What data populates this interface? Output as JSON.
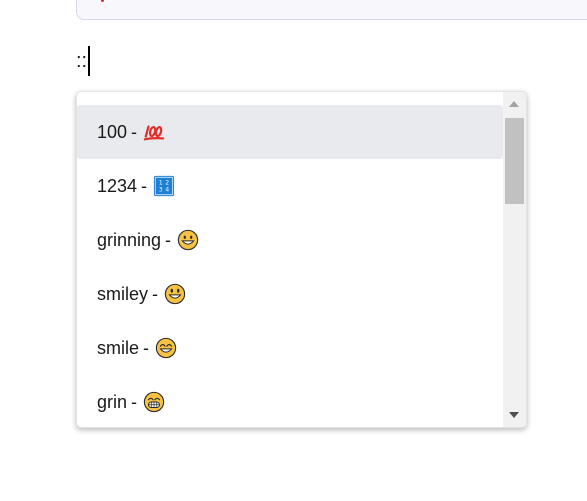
{
  "editor": {
    "typed_text": "::"
  },
  "autocomplete": {
    "items": [
      {
        "label": "100",
        "separator": "-",
        "emoji": "hundred-points-icon",
        "selected": true
      },
      {
        "label": "1234",
        "separator": "-",
        "emoji": "input-numbers-icon",
        "selected": false
      },
      {
        "label": "grinning",
        "separator": "-",
        "emoji": "grinning-face-icon",
        "selected": false
      },
      {
        "label": "smiley",
        "separator": "-",
        "emoji": "smiley-face-icon",
        "selected": false
      },
      {
        "label": "smile",
        "separator": "-",
        "emoji": "smile-face-icon",
        "selected": false
      },
      {
        "label": "grin",
        "separator": "-",
        "emoji": "grin-face-icon",
        "selected": false
      }
    ]
  },
  "colors": {
    "selected_row": "#e8eaed",
    "emoji_yellow": "#f6c244",
    "emoji_red": "#e0302c",
    "emoji_blue": "#1e7fd6"
  }
}
